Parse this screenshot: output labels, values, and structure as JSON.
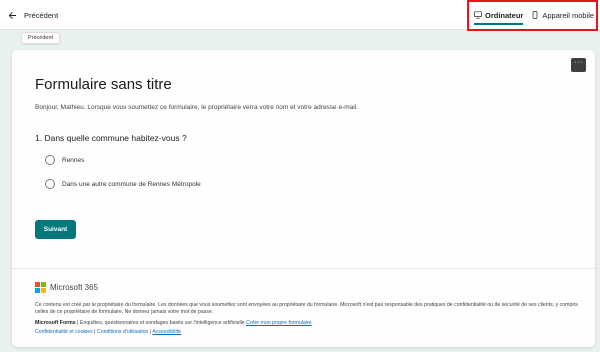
{
  "topbar": {
    "back_label": "Précédent",
    "modes": [
      {
        "label": "Ordinateur",
        "icon": "monitor-icon",
        "active": true
      },
      {
        "label": "Appareil mobile",
        "icon": "mobile-icon",
        "active": false
      }
    ],
    "highlight_color": "#e8141c"
  },
  "chip": {
    "label": "Précédent"
  },
  "form": {
    "more_label": "···",
    "title": "Formulaire sans titre",
    "intro": "Bonjour, Mathieu. Lorsque vous soumettez ce formulaire, le propriétaire verra votre nom et votre adresse e-mail.",
    "question": "1. Dans quelle commune habitez-vous ?",
    "options": [
      {
        "label": "Rennes"
      },
      {
        "label": "Dans une autre commune de Rennes Métropole"
      }
    ],
    "next_label": "Suivant",
    "accent_color": "#03787c"
  },
  "footer": {
    "brand": "Microsoft 365",
    "disclaimer": "Ce contenu est créé par le propriétaire du formulaire. Les données que vous soumettez sont envoyées au propriétaire du formulaire. Microsoft n'est pas responsable des pratiques de confidentialité ou de sécurité de ses clients, y compris celles de ce propriétaire de formulaire. Ne donnez jamais votre mot de passe.",
    "forms_bold": "Microsoft Forms",
    "forms_tagline": " | Enquêtes, questionnaires et sondages basés sur l'intelligence artificielle ",
    "create_link": "Créer mon propre formulaire",
    "links": [
      {
        "label": "Confidentialité et cookies"
      },
      {
        "label": "Conditions d'utilisation"
      },
      {
        "label": "Accessibilité"
      }
    ]
  }
}
